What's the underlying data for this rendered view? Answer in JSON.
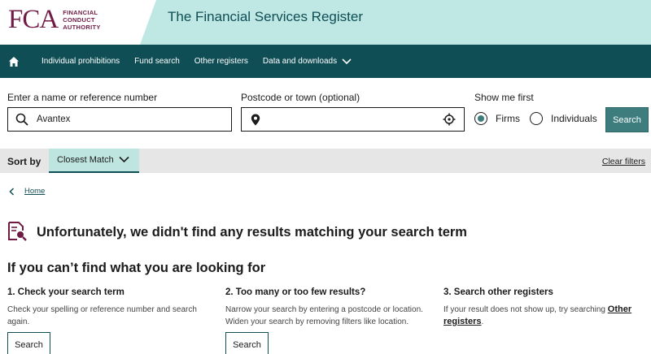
{
  "header": {
    "logo_mark": "FCA",
    "logo_lines": [
      "FINANCIAL",
      "CONDUCT",
      "AUTHORITY"
    ],
    "site_title": "The Financial Services Register",
    "band_color": "#bfe8e4",
    "brand_color": "#701b45"
  },
  "nav": {
    "home_icon": "home-icon",
    "items": [
      {
        "label": "Individual prohibitions"
      },
      {
        "label": "Fund search"
      },
      {
        "label": "Other registers"
      },
      {
        "label": "Data and downloads"
      }
    ],
    "background": "#0f4e55"
  },
  "search": {
    "name_label": "Enter a name or reference number",
    "name_value": "Avantex",
    "postcode_label": "Postcode or town (optional)",
    "postcode_value": "",
    "show_first_label": "Show me first",
    "options": [
      {
        "label": "Firms",
        "selected": true
      },
      {
        "label": "Individuals",
        "selected": false
      }
    ],
    "button_label": "Search"
  },
  "sortbar": {
    "label": "Sort by",
    "selected": "Closest Match",
    "clear_filters": "Clear filters"
  },
  "breadcrumb": {
    "home": "Home"
  },
  "results": {
    "no_results_title": "Unfortunately, we didn't find any results matching your search term",
    "help_title": "If you can’t find what you are looking for",
    "columns": [
      {
        "heading": "1. Check your search term",
        "text": "Check your spelling or reference number and search again.",
        "button": "Search"
      },
      {
        "heading": "2. Too many or too few results?",
        "text": "Narrow your search by entering a postcode or location. Widen your search by removing filters like location.",
        "button": "Search"
      },
      {
        "heading": "3. Search other registers",
        "text_before": "If your result does not show up, try searching ",
        "link": "Other registers",
        "text_after": "."
      }
    ]
  }
}
